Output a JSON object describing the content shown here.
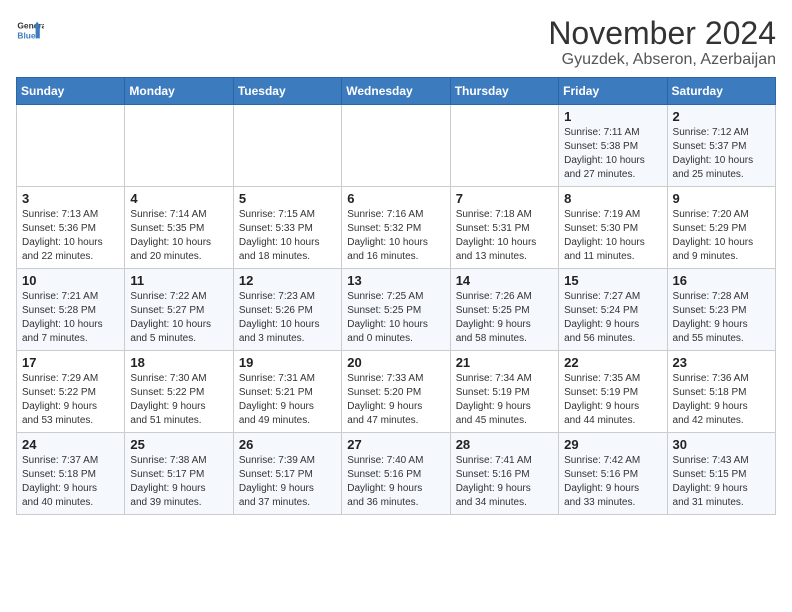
{
  "header": {
    "logo_line1": "General",
    "logo_line2": "Blue",
    "month_title": "November 2024",
    "location": "Gyuzdek, Abseron, Azerbaijan"
  },
  "weekdays": [
    "Sunday",
    "Monday",
    "Tuesday",
    "Wednesday",
    "Thursday",
    "Friday",
    "Saturday"
  ],
  "weeks": [
    [
      {
        "day": "",
        "info": ""
      },
      {
        "day": "",
        "info": ""
      },
      {
        "day": "",
        "info": ""
      },
      {
        "day": "",
        "info": ""
      },
      {
        "day": "",
        "info": ""
      },
      {
        "day": "1",
        "info": "Sunrise: 7:11 AM\nSunset: 5:38 PM\nDaylight: 10 hours\nand 27 minutes."
      },
      {
        "day": "2",
        "info": "Sunrise: 7:12 AM\nSunset: 5:37 PM\nDaylight: 10 hours\nand 25 minutes."
      }
    ],
    [
      {
        "day": "3",
        "info": "Sunrise: 7:13 AM\nSunset: 5:36 PM\nDaylight: 10 hours\nand 22 minutes."
      },
      {
        "day": "4",
        "info": "Sunrise: 7:14 AM\nSunset: 5:35 PM\nDaylight: 10 hours\nand 20 minutes."
      },
      {
        "day": "5",
        "info": "Sunrise: 7:15 AM\nSunset: 5:33 PM\nDaylight: 10 hours\nand 18 minutes."
      },
      {
        "day": "6",
        "info": "Sunrise: 7:16 AM\nSunset: 5:32 PM\nDaylight: 10 hours\nand 16 minutes."
      },
      {
        "day": "7",
        "info": "Sunrise: 7:18 AM\nSunset: 5:31 PM\nDaylight: 10 hours\nand 13 minutes."
      },
      {
        "day": "8",
        "info": "Sunrise: 7:19 AM\nSunset: 5:30 PM\nDaylight: 10 hours\nand 11 minutes."
      },
      {
        "day": "9",
        "info": "Sunrise: 7:20 AM\nSunset: 5:29 PM\nDaylight: 10 hours\nand 9 minutes."
      }
    ],
    [
      {
        "day": "10",
        "info": "Sunrise: 7:21 AM\nSunset: 5:28 PM\nDaylight: 10 hours\nand 7 minutes."
      },
      {
        "day": "11",
        "info": "Sunrise: 7:22 AM\nSunset: 5:27 PM\nDaylight: 10 hours\nand 5 minutes."
      },
      {
        "day": "12",
        "info": "Sunrise: 7:23 AM\nSunset: 5:26 PM\nDaylight: 10 hours\nand 3 minutes."
      },
      {
        "day": "13",
        "info": "Sunrise: 7:25 AM\nSunset: 5:25 PM\nDaylight: 10 hours\nand 0 minutes."
      },
      {
        "day": "14",
        "info": "Sunrise: 7:26 AM\nSunset: 5:25 PM\nDaylight: 9 hours\nand 58 minutes."
      },
      {
        "day": "15",
        "info": "Sunrise: 7:27 AM\nSunset: 5:24 PM\nDaylight: 9 hours\nand 56 minutes."
      },
      {
        "day": "16",
        "info": "Sunrise: 7:28 AM\nSunset: 5:23 PM\nDaylight: 9 hours\nand 55 minutes."
      }
    ],
    [
      {
        "day": "17",
        "info": "Sunrise: 7:29 AM\nSunset: 5:22 PM\nDaylight: 9 hours\nand 53 minutes."
      },
      {
        "day": "18",
        "info": "Sunrise: 7:30 AM\nSunset: 5:22 PM\nDaylight: 9 hours\nand 51 minutes."
      },
      {
        "day": "19",
        "info": "Sunrise: 7:31 AM\nSunset: 5:21 PM\nDaylight: 9 hours\nand 49 minutes."
      },
      {
        "day": "20",
        "info": "Sunrise: 7:33 AM\nSunset: 5:20 PM\nDaylight: 9 hours\nand 47 minutes."
      },
      {
        "day": "21",
        "info": "Sunrise: 7:34 AM\nSunset: 5:19 PM\nDaylight: 9 hours\nand 45 minutes."
      },
      {
        "day": "22",
        "info": "Sunrise: 7:35 AM\nSunset: 5:19 PM\nDaylight: 9 hours\nand 44 minutes."
      },
      {
        "day": "23",
        "info": "Sunrise: 7:36 AM\nSunset: 5:18 PM\nDaylight: 9 hours\nand 42 minutes."
      }
    ],
    [
      {
        "day": "24",
        "info": "Sunrise: 7:37 AM\nSunset: 5:18 PM\nDaylight: 9 hours\nand 40 minutes."
      },
      {
        "day": "25",
        "info": "Sunrise: 7:38 AM\nSunset: 5:17 PM\nDaylight: 9 hours\nand 39 minutes."
      },
      {
        "day": "26",
        "info": "Sunrise: 7:39 AM\nSunset: 5:17 PM\nDaylight: 9 hours\nand 37 minutes."
      },
      {
        "day": "27",
        "info": "Sunrise: 7:40 AM\nSunset: 5:16 PM\nDaylight: 9 hours\nand 36 minutes."
      },
      {
        "day": "28",
        "info": "Sunrise: 7:41 AM\nSunset: 5:16 PM\nDaylight: 9 hours\nand 34 minutes."
      },
      {
        "day": "29",
        "info": "Sunrise: 7:42 AM\nSunset: 5:16 PM\nDaylight: 9 hours\nand 33 minutes."
      },
      {
        "day": "30",
        "info": "Sunrise: 7:43 AM\nSunset: 5:15 PM\nDaylight: 9 hours\nand 31 minutes."
      }
    ]
  ]
}
